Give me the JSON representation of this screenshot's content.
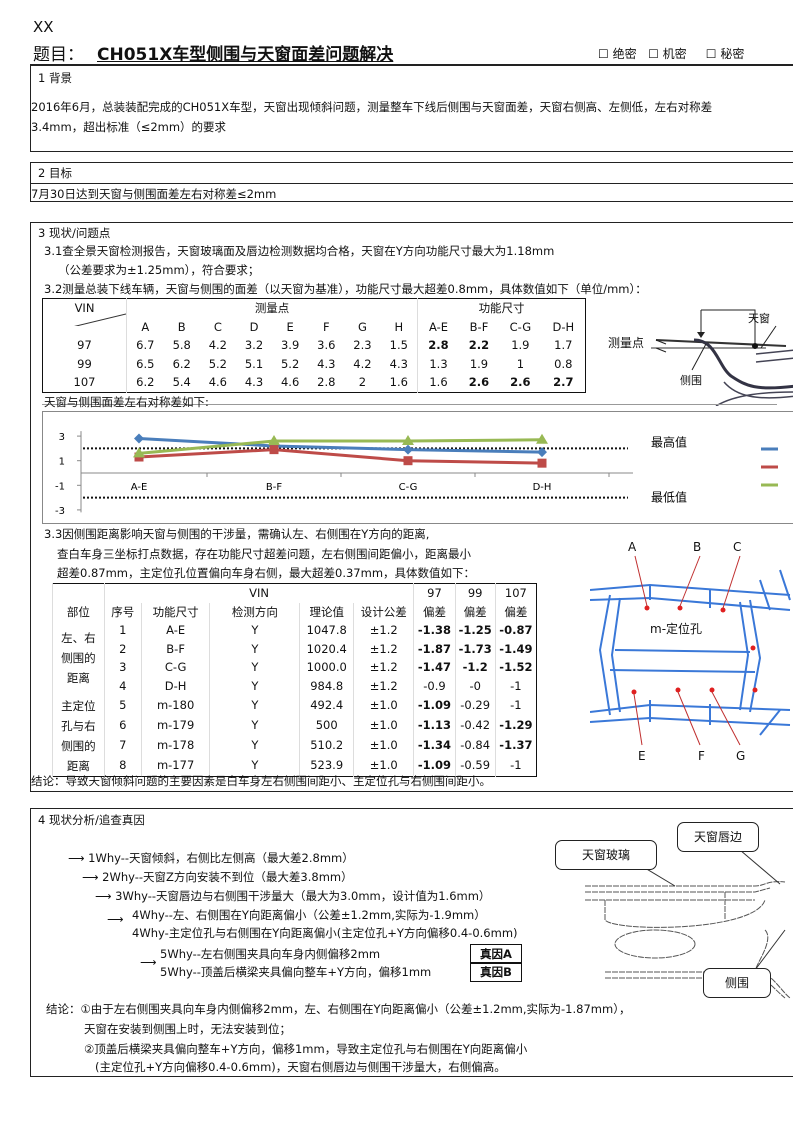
{
  "header": {
    "org": "XX",
    "title_label": "题目：",
    "title": "CH051X车型侧围与天窗面差问题解决",
    "secrecy": [
      {
        "box": "☐",
        "label": "绝密"
      },
      {
        "box": "☐",
        "label": "机密"
      },
      {
        "box": "☐",
        "label": "秘密"
      }
    ]
  },
  "s1": {
    "heading": "1  背景",
    "text1": "2016年6月，总装装配完成的CH051X车型，天窗出现倾斜问题，测量整车下线后侧围与天窗面差，天窗右侧高、左侧低，左右对称差",
    "text2": "3.4mm，超出标准（≤2mm）的要求"
  },
  "s2": {
    "heading": "2  目标",
    "text": "7月30日达到天窗与侧围面差左右对称差≤2mm"
  },
  "s3": {
    "heading": "3  现状/问题点",
    "p31a": "3.1查全景天窗检测报告，天窗玻璃面及唇边检测数据均合格，天窗在Y方向功能尺寸最大为1.18mm",
    "p31b": "（公差要求为±1.25mm），符合要求；",
    "p32": "3.2测量总装下线车辆，天窗与侧围的面差（以天窗为基准），功能尺寸最大超差0.8mm，具体数值如下（单位/mm）：",
    "table1": {
      "vin": "VIN",
      "group1": "测量点",
      "group2": "功能尺寸",
      "cols": [
        "A",
        "B",
        "C",
        "D",
        "E",
        "F",
        "G",
        "H",
        "A-E",
        "B-F",
        "C-G",
        "D-H"
      ],
      "rows": [
        {
          "vin": "97",
          "vals": [
            "6.7",
            "5.8",
            "4.2",
            "3.2",
            "3.9",
            "3.6",
            "2.3",
            "1.5",
            "2.8",
            "2.2",
            "1.9",
            "1.7"
          ],
          "bold": [
            8,
            9
          ]
        },
        {
          "vin": "99",
          "vals": [
            "6.5",
            "6.2",
            "5.2",
            "5.1",
            "5.2",
            "4.3",
            "4.2",
            "4.3",
            "1.3",
            "1.9",
            "1",
            "0.8"
          ],
          "bold": []
        },
        {
          "vin": "107",
          "vals": [
            "6.2",
            "5.4",
            "4.6",
            "4.3",
            "4.6",
            "2.8",
            "2",
            "1.6",
            "1.6",
            "2.6",
            "2.6",
            "2.7"
          ],
          "bold": [
            9,
            10,
            11
          ]
        }
      ]
    },
    "diagram1": {
      "measure_label": "测量点",
      "side_label": "侧围",
      "sunroof_label": "天窗"
    },
    "chart_caption": "天窗与侧围面差左右对称差如下:",
    "p33a": "3.3因侧围距离影响天窗与侧围的干涉量，需确认左、右侧围在Y方向的距离,",
    "p33b": "查白车身三坐标打点数据，存在功能尺寸超差问题，左右侧围间距偏小，距离最小",
    "p33c": "超差0.87mm，主定位孔位置偏向车身右侧，最大超差0.37mm，具体数值如下：",
    "table2": {
      "vin": "VIN",
      "vins": [
        "97",
        "99",
        "107"
      ],
      "headers": [
        "部位",
        "序号",
        "功能尺寸",
        "检测方向",
        "理论值",
        "设计公差",
        "偏差",
        "偏差",
        "偏差"
      ],
      "groups": [
        "左、右侧围的距离",
        "主定位孔与右侧围的距离"
      ],
      "rows": [
        {
          "no": "1",
          "dim": "A-E",
          "dir": "Y",
          "nom": "1047.8",
          "tol": "±1.2",
          "dev": [
            "-1.38",
            "-1.25",
            "-0.87"
          ],
          "bold": [
            0,
            1,
            2
          ]
        },
        {
          "no": "2",
          "dim": "B-F",
          "dir": "Y",
          "nom": "1020.4",
          "tol": "±1.2",
          "dev": [
            "-1.87",
            "-1.73",
            "-1.49"
          ],
          "bold": [
            0,
            1,
            2
          ]
        },
        {
          "no": "3",
          "dim": "C-G",
          "dir": "Y",
          "nom": "1000.0",
          "tol": "±1.2",
          "dev": [
            "-1.47",
            "-1.2",
            "-1.52"
          ],
          "bold": [
            0,
            1,
            2
          ]
        },
        {
          "no": "4",
          "dim": "D-H",
          "dir": "Y",
          "nom": "984.8",
          "tol": "±1.2",
          "dev": [
            "-0.9",
            "-0",
            "-1"
          ],
          "bold": []
        },
        {
          "no": "5",
          "dim": "m-180",
          "dir": "Y",
          "nom": "492.4",
          "tol": "±1.0",
          "dev": [
            "-1.09",
            "-0.29",
            "-1"
          ],
          "bold": [
            0
          ]
        },
        {
          "no": "6",
          "dim": "m-179",
          "dir": "Y",
          "nom": "500",
          "tol": "±1.0",
          "dev": [
            "-1.13",
            "-0.42",
            "-1.29"
          ],
          "bold": [
            0,
            2
          ]
        },
        {
          "no": "7",
          "dim": "m-178",
          "dir": "Y",
          "nom": "510.2",
          "tol": "±1.0",
          "dev": [
            "-1.34",
            "-0.84",
            "-1.37"
          ],
          "bold": [
            0,
            2
          ]
        },
        {
          "no": "8",
          "dim": "m-177",
          "dir": "Y",
          "nom": "523.9",
          "tol": "±1.0",
          "dev": [
            "-1.09",
            "-0.59",
            "-1"
          ],
          "bold": [
            0
          ]
        }
      ]
    },
    "diagram2": {
      "labels": [
        "A",
        "B",
        "C",
        "E",
        "F",
        "G"
      ],
      "hole_label": "m-定位孔",
      "color": "#3a78d8"
    },
    "conclusion": "结论：导致天窗倾斜问题的主要因素是白车身左右侧围间距小、主定位孔与右侧围间距小。"
  },
  "chart_data": {
    "type": "line",
    "categories": [
      "A-E",
      "B-F",
      "C-G",
      "D-H"
    ],
    "series": [
      {
        "values": [
          2.8,
          2.2,
          1.9,
          1.7
        ],
        "color": "#4a7ebb",
        "marker": "diamond"
      },
      {
        "values": [
          1.3,
          1.9,
          1.0,
          0.8
        ],
        "color": "#be4b48",
        "marker": "square"
      },
      {
        "values": [
          1.6,
          2.6,
          2.6,
          2.7
        ],
        "color": "#98b954",
        "marker": "triangle"
      }
    ],
    "yticks": [
      3,
      1,
      -1,
      -3
    ],
    "ylim": [
      -3.5,
      3.8
    ],
    "reference_lines": [
      {
        "value": 2,
        "label": "最高值"
      },
      {
        "value": -2,
        "label": "最低值"
      }
    ],
    "legend": "right"
  },
  "s4": {
    "heading": "4  现状分析/追查真因",
    "whys": [
      "1Why--天窗倾斜，右侧比左侧高（最大差2.8mm）",
      "2Why--天窗Z方向安装不到位（最大差3.8mm）",
      "3Why--天窗唇边与右侧围干涉量大（最大为3.0mm，设计值为1.6mm）",
      "4Why--左、右侧围在Y向距离偏小（公差±1.2mm,实际为-1.9mm）",
      "4Why-主定位孔与右侧围在Y向距离偏小(主定位孔+Y方向偏移0.4-0.6mm)",
      "5Why--左右侧围夹具向车身内侧偏移2mm",
      "5Why--顶盖后横梁夹具偏向整车+Y方向，偏移1mm"
    ],
    "causes": [
      "真因A",
      "真因B"
    ],
    "callouts": {
      "glass": "天窗玻璃",
      "lip": "天窗唇边",
      "side": "侧围"
    },
    "conclusion": [
      "结论：①由于左右侧围夹具向车身内侧偏移2mm，左、右侧围在Y向距离偏小（公差±1.2mm,实际为-1.87mm），",
      "天窗在安装到侧围上时，无法安装到位；",
      "②顶盖后横梁夹具偏向整车+Y方向，偏移1mm，导致主定位孔与右侧围在Y向距离偏小",
      "(主定位孔+Y方向偏移0.4-0.6mm)，天窗右侧唇边与侧围干涉量大，右侧偏高。"
    ]
  }
}
